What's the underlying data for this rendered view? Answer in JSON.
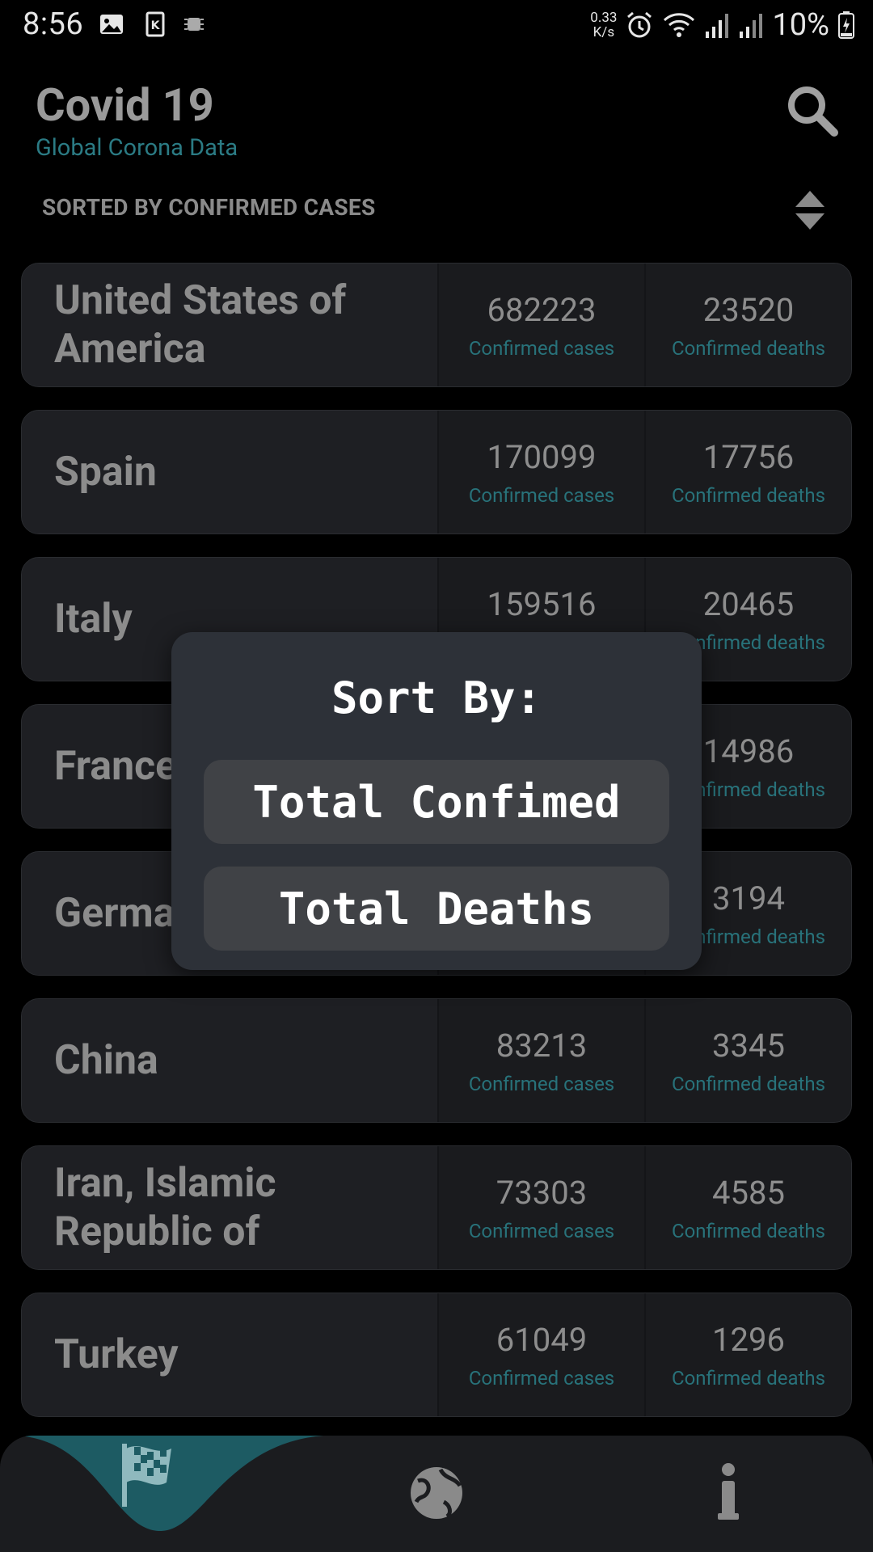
{
  "status_bar": {
    "time": "8:56",
    "net_speed_value": "0.33",
    "net_speed_unit": "K/s",
    "battery": "10%"
  },
  "header": {
    "title": "Covid 19",
    "subtitle": "Global Corona Data"
  },
  "sort": {
    "label": "SORTED BY CONFIRMED CASES"
  },
  "stat_labels": {
    "cases": "Confirmed cases",
    "deaths": "Confirmed deaths"
  },
  "countries": [
    {
      "name": "United States of America",
      "cases": "682223",
      "deaths": "23520"
    },
    {
      "name": "Spain",
      "cases": "170099",
      "deaths": "17756"
    },
    {
      "name": "Italy",
      "cases": "159516",
      "deaths": "20465"
    },
    {
      "name": "France",
      "cases": "",
      "deaths": "14986"
    },
    {
      "name": "Germany",
      "cases": "",
      "deaths": "3194"
    },
    {
      "name": "China",
      "cases": "83213",
      "deaths": "3345"
    },
    {
      "name": "Iran, Islamic Republic of",
      "cases": "73303",
      "deaths": "4585"
    },
    {
      "name": "Turkey",
      "cases": "61049",
      "deaths": "1296"
    }
  ],
  "dialog": {
    "title": "Sort By:",
    "option_confirmed": "Total Confimed",
    "option_deaths": "Total Deaths"
  },
  "colors": {
    "accent": "#1d5b63",
    "background": "#000000",
    "card": "#1c1d21",
    "dialog": "#2d3138"
  },
  "nav": {
    "items": [
      "flag-icon",
      "globe-icon",
      "info-icon"
    ]
  }
}
